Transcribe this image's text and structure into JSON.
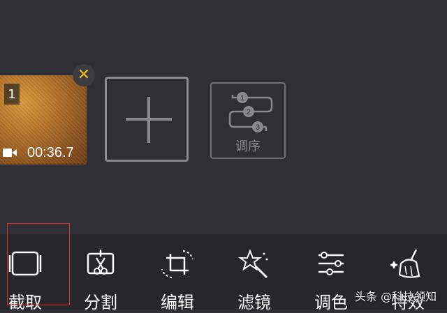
{
  "clip": {
    "index": "1",
    "duration": "00:36.7",
    "close_symbol": "✕"
  },
  "order_button": {
    "label": "调序",
    "steps": [
      "1",
      "2",
      "3"
    ]
  },
  "toolbar": {
    "items": [
      {
        "label": "截取",
        "icon": "crop-frame-icon"
      },
      {
        "label": "分割",
        "icon": "split-scissors-icon"
      },
      {
        "label": "编辑",
        "icon": "crop-rotate-icon"
      },
      {
        "label": "滤镜",
        "icon": "magic-wand-icon"
      },
      {
        "label": "调色",
        "icon": "sliders-icon"
      },
      {
        "label": "特效",
        "icon": "broom-sparkle-icon"
      }
    ]
  },
  "watermark": "头条 @科技领知",
  "colors": {
    "background": "#2f2f35",
    "toolbar": "#26262b",
    "accent": "#f3c51a",
    "highlight_frame": "#e0322b"
  }
}
